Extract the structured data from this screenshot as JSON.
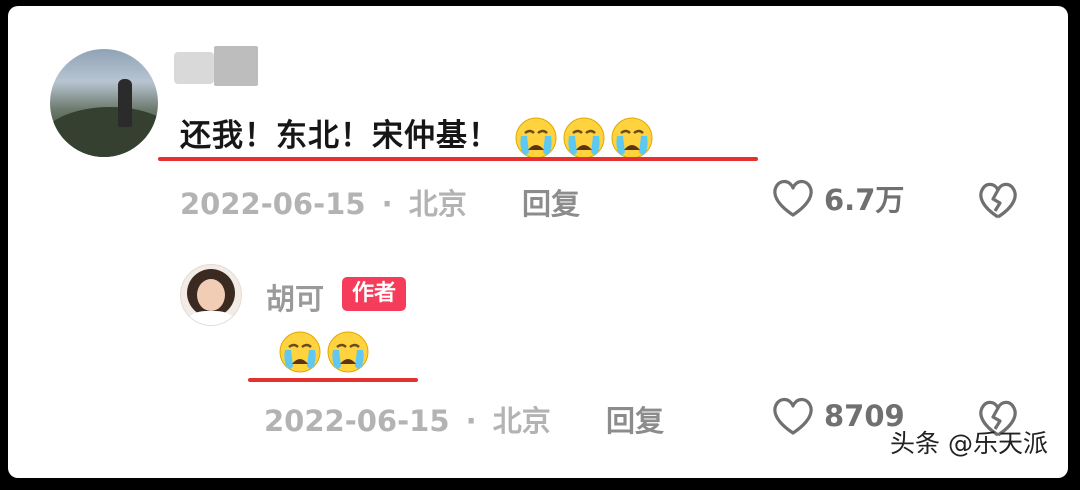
{
  "comment": {
    "text": "还我！东北！宋仲基！",
    "emoji_count": 3,
    "emoji": "loudly-crying-face",
    "date": "2022-06-15",
    "separator": "·",
    "location": "北京",
    "reply_label": "回复",
    "likes": "6.7万"
  },
  "reply": {
    "author_name": "胡可",
    "author_badge": "作者",
    "emoji_count": 2,
    "emoji": "loudly-crying-face",
    "date": "2022-06-15",
    "separator": "·",
    "location": "北京",
    "reply_label": "回复",
    "likes": "8709"
  },
  "watermark": "头条 @乐天派",
  "colors": {
    "underline": "#e53030",
    "badge": "#f53c5a",
    "meta_text": "#b3b3b3"
  }
}
